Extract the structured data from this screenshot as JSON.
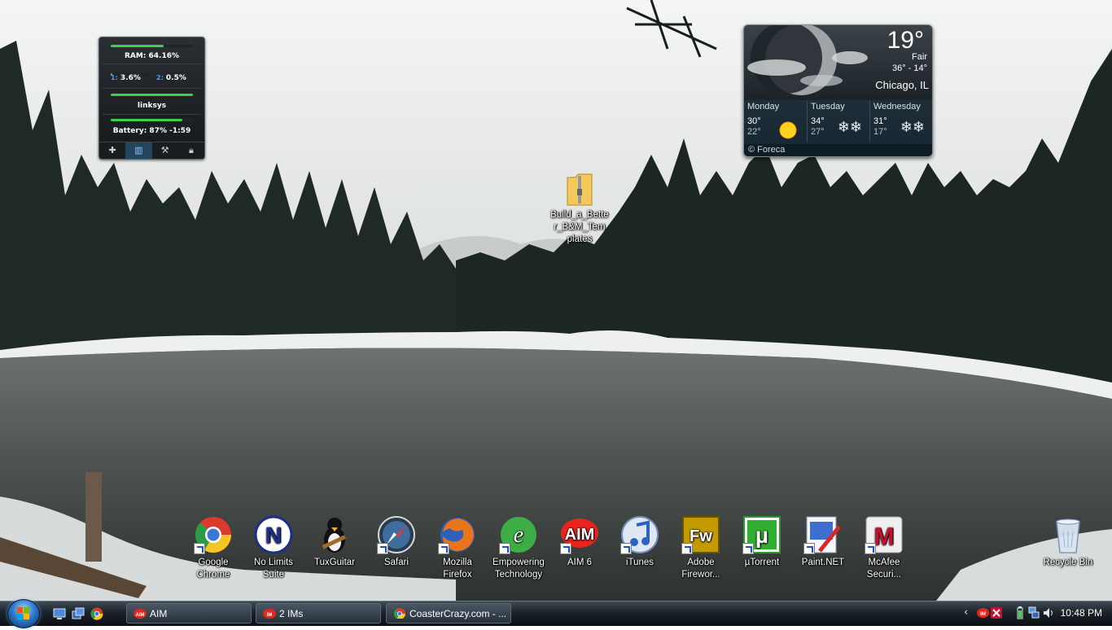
{
  "meter_gadget": {
    "ram_label": "RAM: 64.16%",
    "ram_level": 0.64,
    "cpu1": "3.6%",
    "cpu2": "0.5%",
    "network_label": "linksys",
    "network_level": 1.0,
    "battery_label": "Battery: 87% -1:59",
    "battery_level": 0.87,
    "tools": [
      "plus-icon",
      "meter-icon",
      "wrench-icon",
      "lock-icon"
    ]
  },
  "weather_gadget": {
    "temperature": "19°",
    "condition": "Fair",
    "range": "36° - 14°",
    "city": "Chicago, IL",
    "forecast": [
      {
        "day": "Monday",
        "hi": "30°",
        "lo": "22°",
        "icon": "sun-icon"
      },
      {
        "day": "Tuesday",
        "hi": "34°",
        "lo": "27°",
        "icon": "snow-icon"
      },
      {
        "day": "Wednesday",
        "hi": "31°",
        "lo": "17°",
        "icon": "snow-icon"
      }
    ],
    "credit": "© Foreca"
  },
  "desktop": {
    "folder": {
      "label": "Build_a_Bette r_B&M_Tem plates",
      "icon": "zip-folder-icon"
    },
    "icons": [
      {
        "label": "Google Chrome",
        "icon": "chrome-icon"
      },
      {
        "label": "No Limits Suite",
        "icon": "nolimits-icon"
      },
      {
        "label": "TuxGuitar",
        "icon": "tux-icon"
      },
      {
        "label": "Safari",
        "icon": "safari-icon"
      },
      {
        "label": "Mozilla Firefox",
        "icon": "firefox-icon"
      },
      {
        "label": "Empowering Technology",
        "icon": "empowering-icon"
      },
      {
        "label": "AIM 6",
        "icon": "aim-icon"
      },
      {
        "label": "iTunes",
        "icon": "itunes-icon"
      },
      {
        "label": "Adobe Firewor...",
        "icon": "fireworks-icon"
      },
      {
        "label": "µTorrent",
        "icon": "utorrent-icon"
      },
      {
        "label": "Paint.NET",
        "icon": "paintnet-icon"
      },
      {
        "label": "McAfee Securi...",
        "icon": "mcafee-icon"
      }
    ],
    "recycle_bin": {
      "label": "Recycle Bin",
      "icon": "recycle-bin-icon"
    }
  },
  "taskbar": {
    "start_icon": "windows-start-icon",
    "quick_launch": [
      "show-desktop-icon",
      "switch-windows-icon",
      "chrome-icon"
    ],
    "tasks": [
      {
        "label": "AIM",
        "icon": "aim-icon"
      },
      {
        "label": "2 IMs",
        "icon": "aim-icon"
      },
      {
        "label": "CoasterCrazy.com - ...",
        "icon": "chrome-icon"
      }
    ],
    "tray_icons": [
      "chevron-left-icon",
      "aim-tray-icon",
      "mcafee-tray-icon",
      "battery-icon",
      "network-icon",
      "volume-icon"
    ],
    "clock": "10:48 PM"
  }
}
